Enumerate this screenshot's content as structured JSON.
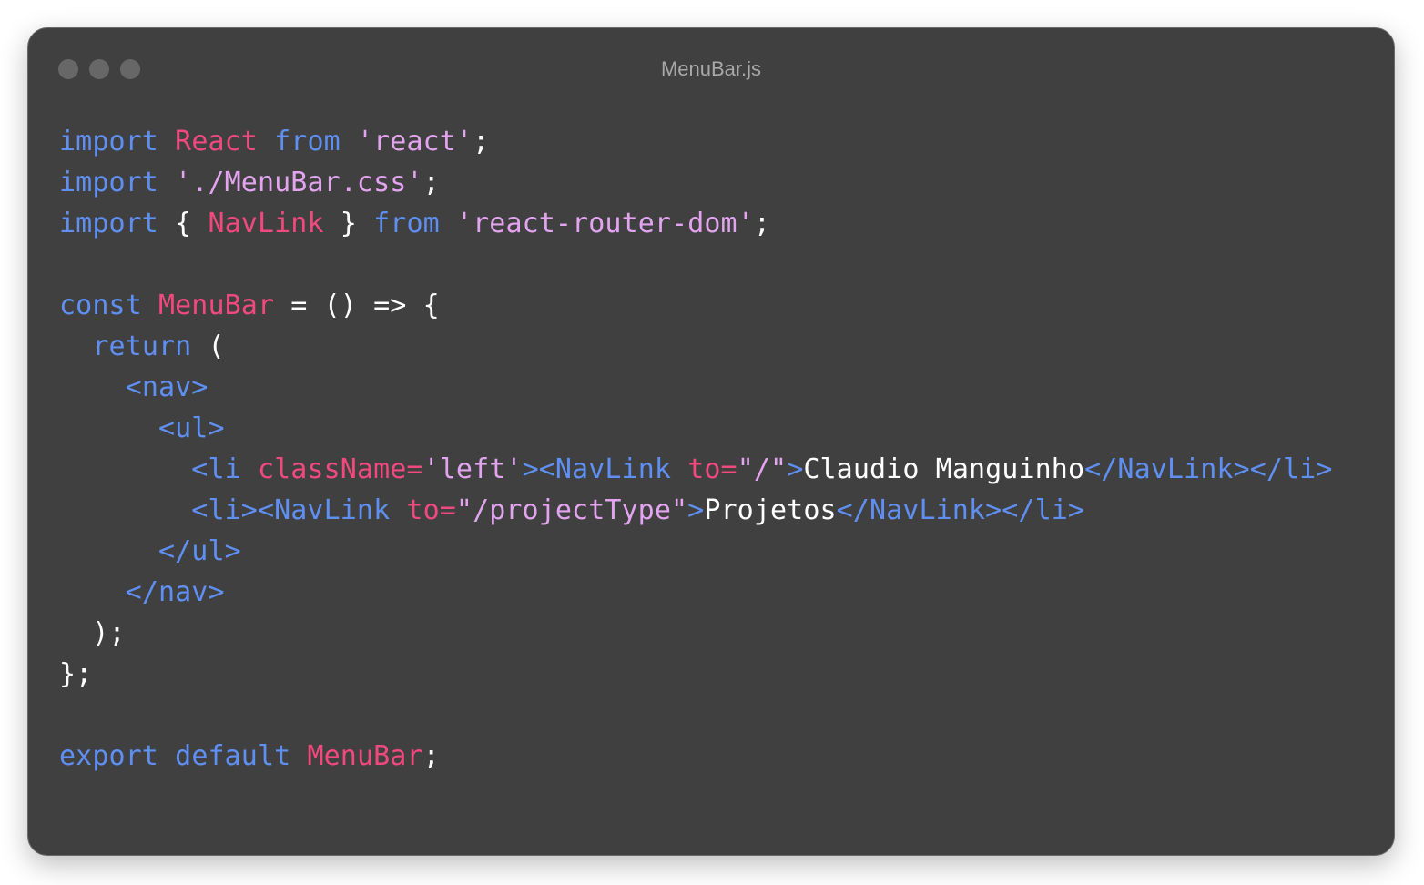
{
  "window": {
    "title": "MenuBar.js",
    "controls": [
      "close",
      "minimize",
      "zoom"
    ]
  },
  "colors": {
    "background": "#404040",
    "keyword": "#5f8ff2",
    "identifier": "#f0487f",
    "string": "#e2a4ee",
    "plain": "#ffffff"
  },
  "code": {
    "lines": [
      [
        [
          "import",
          "kw"
        ],
        [
          " ",
          "pl"
        ],
        [
          "React",
          "id"
        ],
        [
          " ",
          "pl"
        ],
        [
          "from",
          "kw"
        ],
        [
          " ",
          "pl"
        ],
        [
          "'react'",
          "str"
        ],
        [
          ";",
          "pl"
        ]
      ],
      [
        [
          "import",
          "kw"
        ],
        [
          " ",
          "pl"
        ],
        [
          "'./MenuBar.css'",
          "str"
        ],
        [
          ";",
          "pl"
        ]
      ],
      [
        [
          "import",
          "kw"
        ],
        [
          " { ",
          "pl"
        ],
        [
          "NavLink",
          "id"
        ],
        [
          " } ",
          "pl"
        ],
        [
          "from",
          "kw"
        ],
        [
          " ",
          "pl"
        ],
        [
          "'react-router-dom'",
          "str"
        ],
        [
          ";",
          "pl"
        ]
      ],
      [],
      [
        [
          "const",
          "kw"
        ],
        [
          " ",
          "pl"
        ],
        [
          "MenuBar",
          "id"
        ],
        [
          " = () => {",
          "pl"
        ]
      ],
      [
        [
          "  ",
          "pl"
        ],
        [
          "return",
          "kw"
        ],
        [
          " (",
          "pl"
        ]
      ],
      [
        [
          "    ",
          "pl"
        ],
        [
          "<nav>",
          "tag"
        ]
      ],
      [
        [
          "      ",
          "pl"
        ],
        [
          "<ul>",
          "tag"
        ]
      ],
      [
        [
          "        ",
          "pl"
        ],
        [
          "<li ",
          "tag"
        ],
        [
          "className=",
          "attr"
        ],
        [
          "'left'",
          "str"
        ],
        [
          "><NavLink ",
          "tag"
        ],
        [
          "to=",
          "attr"
        ],
        [
          "\"/\"",
          "str"
        ],
        [
          ">",
          "tag"
        ],
        [
          "Claudio Manguinho",
          "pl"
        ],
        [
          "</NavLink></li>",
          "tag"
        ]
      ],
      [
        [
          "        ",
          "pl"
        ],
        [
          "<li><NavLink ",
          "tag"
        ],
        [
          "to=",
          "attr"
        ],
        [
          "\"/projectType\"",
          "str"
        ],
        [
          ">",
          "tag"
        ],
        [
          "Projetos",
          "pl"
        ],
        [
          "</NavLink></li>",
          "tag"
        ]
      ],
      [
        [
          "      ",
          "pl"
        ],
        [
          "</ul>",
          "tag"
        ]
      ],
      [
        [
          "    ",
          "pl"
        ],
        [
          "</nav>",
          "tag"
        ]
      ],
      [
        [
          "  );",
          "pl"
        ]
      ],
      [
        [
          "};",
          "pl"
        ]
      ],
      [],
      [
        [
          "export",
          "kw"
        ],
        [
          " ",
          "pl"
        ],
        [
          "default",
          "kw"
        ],
        [
          " ",
          "pl"
        ],
        [
          "MenuBar",
          "id"
        ],
        [
          ";",
          "pl"
        ]
      ]
    ]
  }
}
